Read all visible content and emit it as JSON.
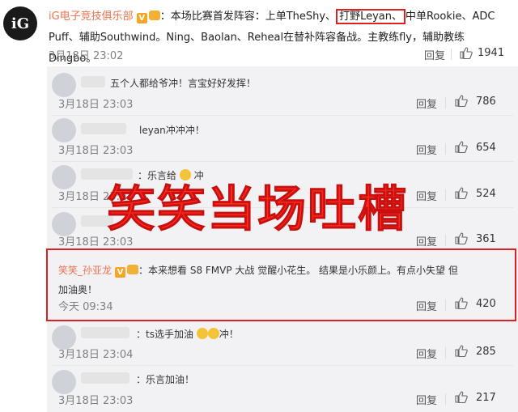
{
  "original_post": {
    "avatar_text": "iG",
    "account_name": "iG电子竞技俱乐部",
    "text_before": "：本场比赛首发阵容：上单TheShy、",
    "text_highlight": "打野Leyan、",
    "text_after1": "中单Rookie、ADC",
    "text_line2": "Puff、辅助Southwind。Ning、Baolan、Reheal在替补阵容备战。主教练fly，辅助教练Dingbo。",
    "time": "3月18日 23:02",
    "reply_label": "回复",
    "likes": "1941"
  },
  "comments": [
    {
      "text": "五个人都给爷冲！言宝好好发挥！",
      "time": "3月18日 23:03",
      "reply_label": "回复",
      "likes": "786"
    },
    {
      "text": "leyan冲冲冲！",
      "time": "3月18日 23:03",
      "reply_label": "回复",
      "likes": "654"
    },
    {
      "text": "：乐言给",
      "text2": "冲",
      "time": "3月18日 23:03",
      "reply_label": "回复",
      "likes": "524"
    },
    {
      "text": "",
      "time": "3月18日 23:03",
      "reply_label": "回复",
      "likes": "361"
    },
    {
      "author": "笑笑_孙亚龙",
      "text": "：本来想看 S8 FMVP 大战 觉醒小花生。 结果是小乐颜上。有点小失望 但",
      "text_line2": "加油奥！",
      "time": "今天 09:34",
      "reply_label": "回复",
      "likes": "420"
    },
    {
      "text": "：ts选手加油",
      "text2": "冲！",
      "time": "3月18日 23:04",
      "reply_label": "回复",
      "likes": "285"
    },
    {
      "text": "：乐言加油！",
      "time": "3月18日 23:03",
      "reply_label": "回复",
      "likes": "217"
    }
  ],
  "overlay_caption": "笑笑当场吐槽",
  "colors": {
    "accent_name": "#eb7350",
    "highlight_red": "#e02020",
    "overlay_red": "#ff2a1a"
  }
}
